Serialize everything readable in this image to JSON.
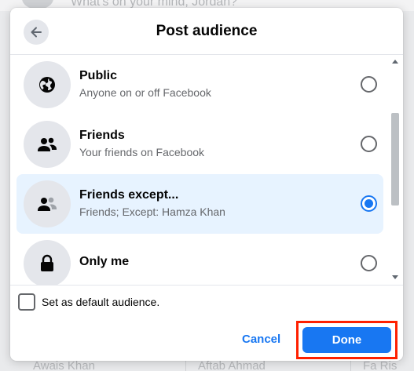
{
  "background": {
    "composer_placeholder": "What's on your mind, Jordan?",
    "names": [
      "Awais Khan",
      "Aftab Ahmad",
      "Fa Ris"
    ]
  },
  "dialog": {
    "title": "Post audience",
    "back_icon": "arrow-left-icon"
  },
  "options": [
    {
      "title": "Public",
      "subtitle": "Anyone on or off Facebook",
      "icon": "globe-icon",
      "selected": false
    },
    {
      "title": "Friends",
      "subtitle": "Your friends on Facebook",
      "icon": "friends-icon",
      "selected": false
    },
    {
      "title": "Friends except...",
      "subtitle": "Friends; Except: Hamza Khan",
      "icon": "friends-except-icon",
      "selected": true
    },
    {
      "title": "Only me",
      "subtitle": "",
      "icon": "lock-icon",
      "selected": false
    }
  ],
  "default_checkbox": {
    "label": "Set as default audience.",
    "checked": false
  },
  "footer": {
    "cancel_label": "Cancel",
    "done_label": "Done"
  },
  "colors": {
    "accent": "#1877f2",
    "selected_bg": "#e7f3ff",
    "highlight_border": "#ff2000"
  }
}
